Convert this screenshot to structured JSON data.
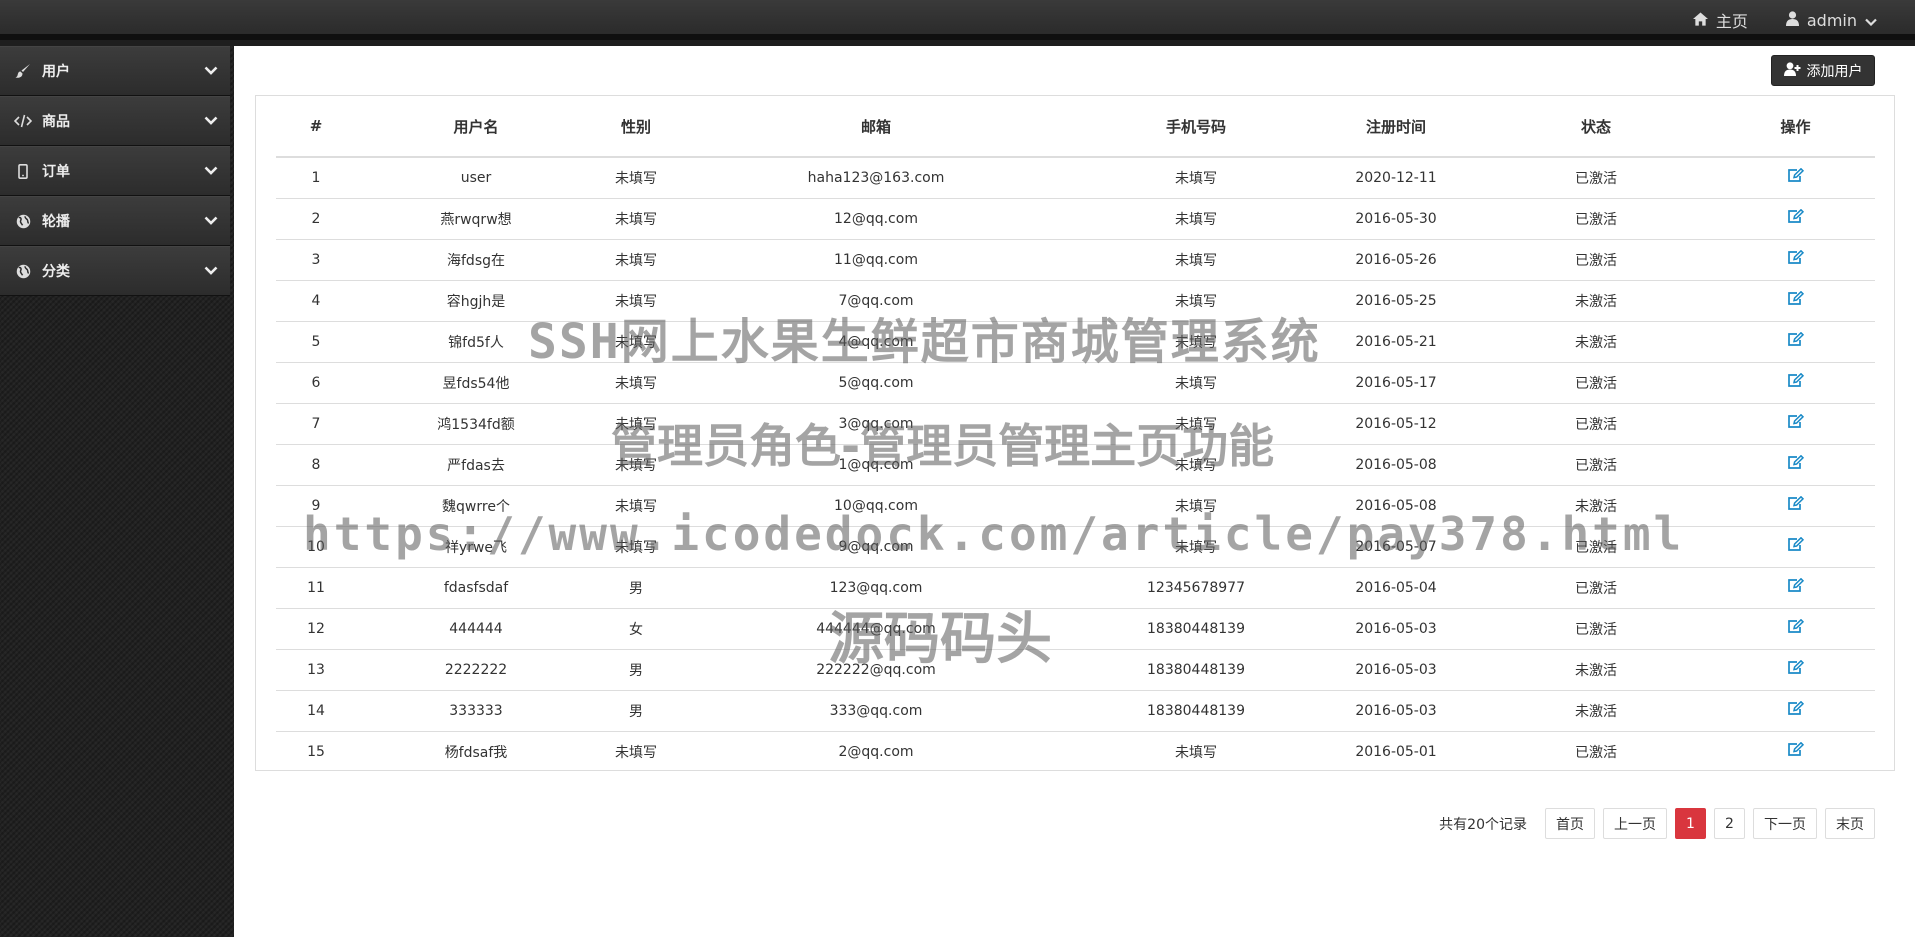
{
  "topbar": {
    "home_label": "主页",
    "user_label": "admin"
  },
  "sidebar": {
    "items": [
      {
        "label": "用户",
        "icon": "brush-icon"
      },
      {
        "label": "商品",
        "icon": "code-icon"
      },
      {
        "label": "订单",
        "icon": "mobile-icon"
      },
      {
        "label": "轮播",
        "icon": "globe-icon"
      },
      {
        "label": "分类",
        "icon": "globe-icon"
      }
    ]
  },
  "toolbar": {
    "add_user_label": "添加用户"
  },
  "table": {
    "headers": [
      "#",
      "用户名",
      "性别",
      "邮箱",
      "手机号码",
      "注册时间",
      "状态",
      "操作"
    ],
    "rows": [
      [
        "1",
        "user",
        "未填写",
        "haha123@163.com",
        "未填写",
        "2020-12-11",
        "已激活"
      ],
      [
        "2",
        "燕rwqrw想",
        "未填写",
        "12@qq.com",
        "未填写",
        "2016-05-30",
        "已激活"
      ],
      [
        "3",
        "海fdsg在",
        "未填写",
        "11@qq.com",
        "未填写",
        "2016-05-26",
        "已激活"
      ],
      [
        "4",
        "容hgjh是",
        "未填写",
        "7@qq.com",
        "未填写",
        "2016-05-25",
        "未激活"
      ],
      [
        "5",
        "锦fd5f人",
        "未填写",
        "4@qq.com",
        "未填写",
        "2016-05-21",
        "未激活"
      ],
      [
        "6",
        "昱fds54他",
        "未填写",
        "5@qq.com",
        "未填写",
        "2016-05-17",
        "已激活"
      ],
      [
        "7",
        "鸿1534fd额",
        "未填写",
        "3@qq.com",
        "未填写",
        "2016-05-12",
        "已激活"
      ],
      [
        "8",
        "严fdas去",
        "未填写",
        "1@qq.com",
        "未填写",
        "2016-05-08",
        "已激活"
      ],
      [
        "9",
        "魏qwrre个",
        "未填写",
        "10@qq.com",
        "未填写",
        "2016-05-08",
        "未激活"
      ],
      [
        "10",
        "祥yrwe飞",
        "未填写",
        "9@qq.com",
        "未填写",
        "2016-05-07",
        "已激活"
      ],
      [
        "11",
        "fdasfsdaf",
        "男",
        "123@qq.com",
        "12345678977",
        "2016-05-04",
        "已激活"
      ],
      [
        "12",
        "444444",
        "女",
        "444444@qq.com",
        "18380448139",
        "2016-05-03",
        "已激活"
      ],
      [
        "13",
        "2222222",
        "男",
        "222222@qq.com",
        "18380448139",
        "2016-05-03",
        "未激活"
      ],
      [
        "14",
        "333333",
        "男",
        "333@qq.com",
        "18380448139",
        "2016-05-03",
        "未激活"
      ],
      [
        "15",
        "杨fdsaf我",
        "未填写",
        "2@qq.com",
        "未填写",
        "2016-05-01",
        "已激活"
      ]
    ]
  },
  "pager": {
    "total": "共有20个记录",
    "first": "首页",
    "prev": "上一页",
    "pages": [
      "1",
      "2"
    ],
    "current": "1",
    "next": "下一页",
    "last": "末页"
  },
  "watermark": {
    "line1": "SSH网上水果生鲜超市商城管理系统",
    "line2": "管理员角色-管理员管理主页功能",
    "line3": "https://www.icodedock.com/article/pay378.html",
    "line4": "源码码头"
  }
}
